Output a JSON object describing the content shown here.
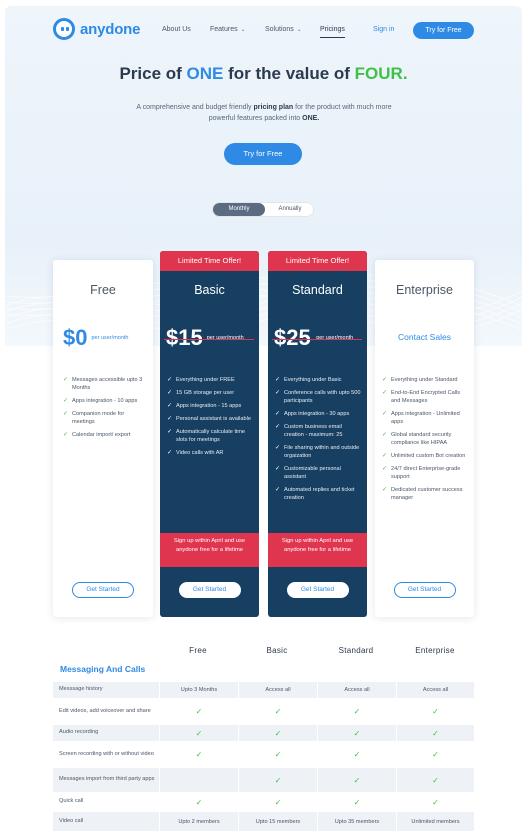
{
  "brand": {
    "name": "anydone",
    "color": "#2f8ae5",
    "logo_icon": "anydone-logo-icon"
  },
  "nav": {
    "items": [
      {
        "label": "About Us"
      },
      {
        "label": "Features"
      },
      {
        "label": "Solutions"
      },
      {
        "label": "Pricings"
      }
    ],
    "dropdown_icon": "chevron-down-icon",
    "signin": "Sign in",
    "cta": "Try for Free"
  },
  "hero": {
    "title_part1": "Price of ",
    "title_one": "ONE",
    "title_part2": " for the value of ",
    "title_four": "FOUR.",
    "subtitle_part1": "A comprehensive and budget friendly ",
    "subtitle_bold1": "pricing plan",
    "subtitle_part2": " for the product with much more powerful features packed into ",
    "subtitle_bold2": "ONE.",
    "cta": "Try for Free"
  },
  "billing_toggle": {
    "monthly": "Monthly",
    "annually": "Annually",
    "selected": "Monthly"
  },
  "plans": [
    {
      "name": "Free",
      "price": "$0",
      "per": "per user/month",
      "features": [
        "Messages accessible upto 3 Months",
        "Apps integration - 10 apps",
        "Companion mode for meetings",
        "Calendar import/ export"
      ],
      "cta": "Get Started"
    },
    {
      "name": "Basic",
      "offer": "Limited Time Offer!",
      "price": "$15",
      "per": "per user/month",
      "features": [
        "Everything under FREE",
        "15 GB storage per user",
        "Apps integration - 15 apps",
        "Personal assistant is available",
        "Automatically calculate time slots for meetings",
        "Video calls with AR"
      ],
      "promo": "Sign up within April and use anydone free for a lifetime",
      "cta": "Get Started"
    },
    {
      "name": "Standard",
      "offer": "Limited Time Offer!",
      "price": "$25",
      "per": "per user/month",
      "features": [
        "Everything under Basic",
        "Conference calls with upto 500 participants",
        "Apps integration - 30 apps",
        "Custom business email creation - maximum: 25",
        "File sharing within and outside orgaization",
        "Customizable personal assistant",
        "Automated replies and ticket creation"
      ],
      "promo": "Sign up within April and use anydone free for a lifetime",
      "cta": "Get Started"
    },
    {
      "name": "Enterprise",
      "contact": "Contact Sales",
      "features": [
        "Everything under Standard",
        "End-to-End Encrypted Calls and Messages",
        "Apps integration - Unlimited apps",
        "Global standard security compliance like HIPAA",
        "Unlimited custom Bot creation",
        "24/7 direct Enterprise-grade support",
        "Dedicated customer success manager"
      ],
      "cta": "Get Started"
    }
  ],
  "comparison": {
    "columns": [
      "Free",
      "Basic",
      "Standard",
      "Enterprise"
    ],
    "section": "Messaging And Calls",
    "rows": [
      {
        "label": "Messsage history",
        "values": [
          "Upto 3 Months",
          "Access all",
          "Access all",
          "Access all"
        ]
      },
      {
        "label": "Edit videos, add voiceover and share",
        "values": [
          "✓",
          "✓",
          "✓",
          "✓"
        ]
      },
      {
        "label": "Audio recording",
        "values": [
          "✓",
          "✓",
          "✓",
          "✓"
        ]
      },
      {
        "label": "Screen recording with or without video",
        "values": [
          "✓",
          "✓",
          "✓",
          "✓"
        ]
      },
      {
        "label": "Messages import from third party apps",
        "values": [
          "",
          "✓",
          "✓",
          "✓"
        ]
      },
      {
        "label": "Quick call",
        "values": [
          "✓",
          "✓",
          "✓",
          "✓"
        ]
      },
      {
        "label": "Video call",
        "values": [
          "Upto 2 members",
          "Upto 15 members",
          "Upto 35 members",
          "Unlimited members"
        ]
      }
    ]
  },
  "colors": {
    "primary": "#2f8ae5",
    "accent_green": "#3fbf4a",
    "offer_red": "#e0354f",
    "dark_card": "#163f62"
  },
  "icons": {
    "check": "check-icon"
  }
}
